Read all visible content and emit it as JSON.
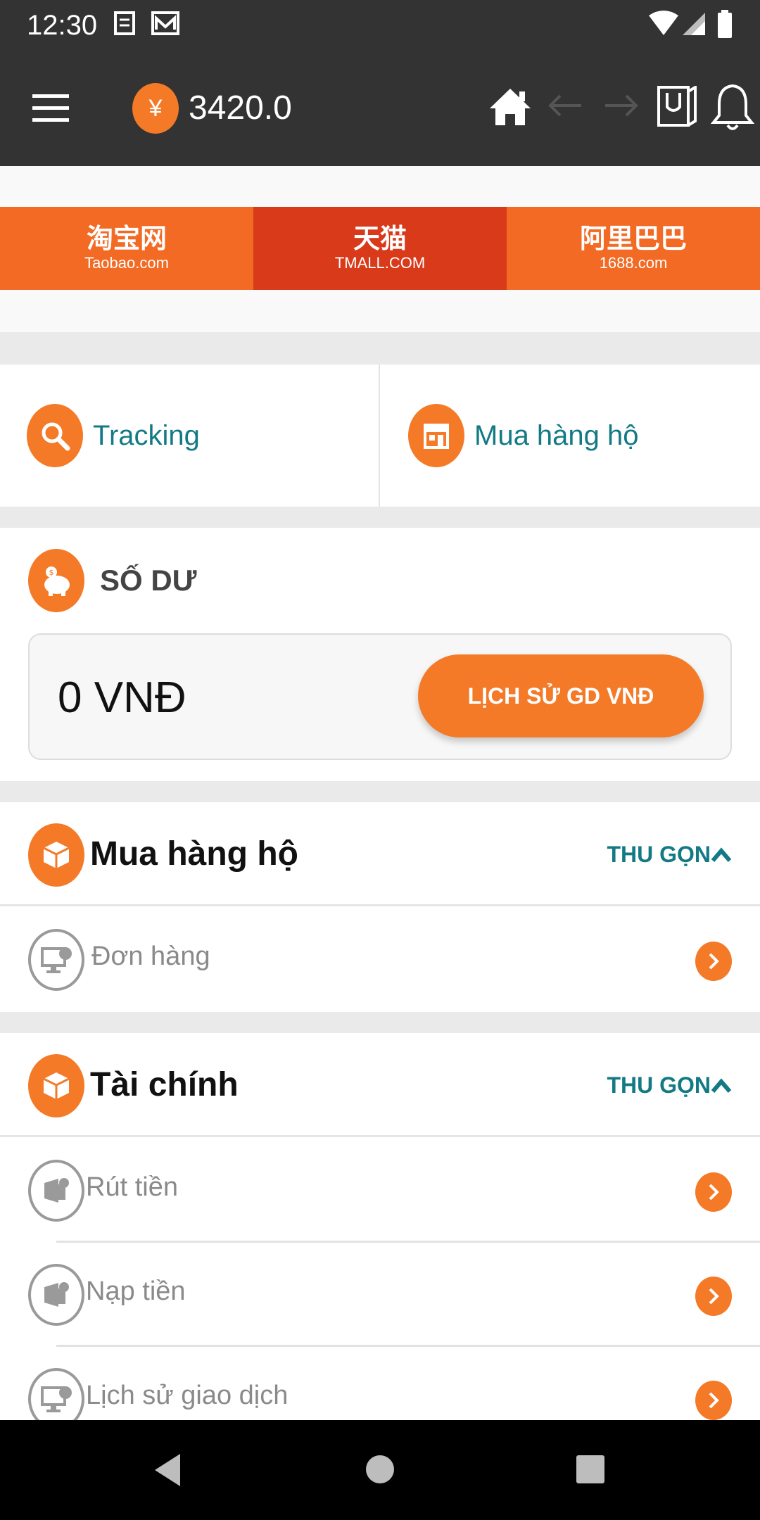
{
  "status_bar": {
    "time": "12:30"
  },
  "app_bar": {
    "currency_symbol": "¥",
    "balance": "3420.0"
  },
  "banners": [
    {
      "cn": "淘宝网",
      "en": "Taobao.com"
    },
    {
      "cn": "天猫",
      "en": "TMALL.COM"
    },
    {
      "cn": "阿里巴巴",
      "en": "1688.com"
    }
  ],
  "quick_actions": {
    "tracking": "Tracking",
    "buy": "Mua hàng hộ"
  },
  "balance_card": {
    "title": "SỐ DƯ",
    "amount": "0 VNĐ",
    "history_button": "LỊCH SỬ GD VNĐ"
  },
  "sections": {
    "purchase": {
      "title": "Mua hàng hộ",
      "collapse": "THU GỌN",
      "items": [
        "Đơn hàng"
      ]
    },
    "finance": {
      "title": "Tài chính",
      "collapse": "THU GỌN",
      "items": [
        "Rút tiền",
        "Nạp tiền",
        "Lịch sử giao dịch"
      ]
    }
  },
  "colors": {
    "accent": "#f47a28",
    "teal": "#137a85",
    "bar": "#333333"
  }
}
